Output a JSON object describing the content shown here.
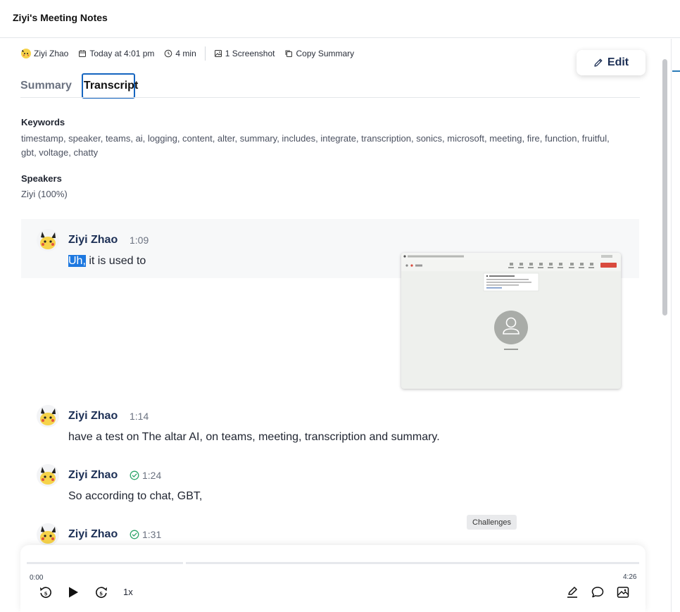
{
  "window": {
    "title": "Ziyi's Meeting Notes"
  },
  "meta": {
    "owner": "Ziyi Zhao",
    "date": "Today at 4:01 pm",
    "duration": "4 min",
    "screenshots": "1 Screenshot",
    "copy_label": "Copy Summary"
  },
  "edit_label": "Edit",
  "tabs": [
    {
      "label": "Summary",
      "active": false
    },
    {
      "label": "Transcript",
      "active": true
    }
  ],
  "keywords": {
    "heading": "Keywords",
    "text": "timestamp, speaker, teams, ai, logging, content, alter, summary, includes, integrate, transcription, sonics, microsoft, meeting, fire, function, fruitful, gbt, voltage, chatty"
  },
  "speakers": {
    "heading": "Speakers",
    "text": "Ziyi (100%)"
  },
  "transcript": [
    {
      "speaker": "Ziyi Zhao",
      "time": "1:09",
      "verified": false,
      "selected_text": "Uh,",
      "text": " it is used to"
    },
    {
      "speaker": "Ziyi Zhao",
      "time": "1:14",
      "verified": false,
      "text": "have a test on The altar AI, on teams, meeting, transcription and summary."
    },
    {
      "speaker": "Ziyi Zhao",
      "time": "1:24",
      "verified": true,
      "text": "So according to chat, GBT,"
    },
    {
      "speaker": "Ziyi Zhao",
      "time": "1:31",
      "verified": true,
      "text": ""
    }
  ],
  "tooltip": "Challenges",
  "player": {
    "current_time": "0:00",
    "total_time": "4:26",
    "speed": "1x",
    "progress": 0.0
  },
  "colors": {
    "accent": "#1565c0",
    "name_text": "#1c2f55",
    "verified": "#2ea66b",
    "selection": "#1d78e0"
  },
  "icons": [
    "calendar-icon",
    "clock-icon",
    "image-icon",
    "copy-icon",
    "pencil-icon",
    "check-circle-icon",
    "rewind-5-icon",
    "play-icon",
    "forward-5-icon",
    "highlight-icon",
    "comment-icon",
    "screenshot-icon"
  ]
}
